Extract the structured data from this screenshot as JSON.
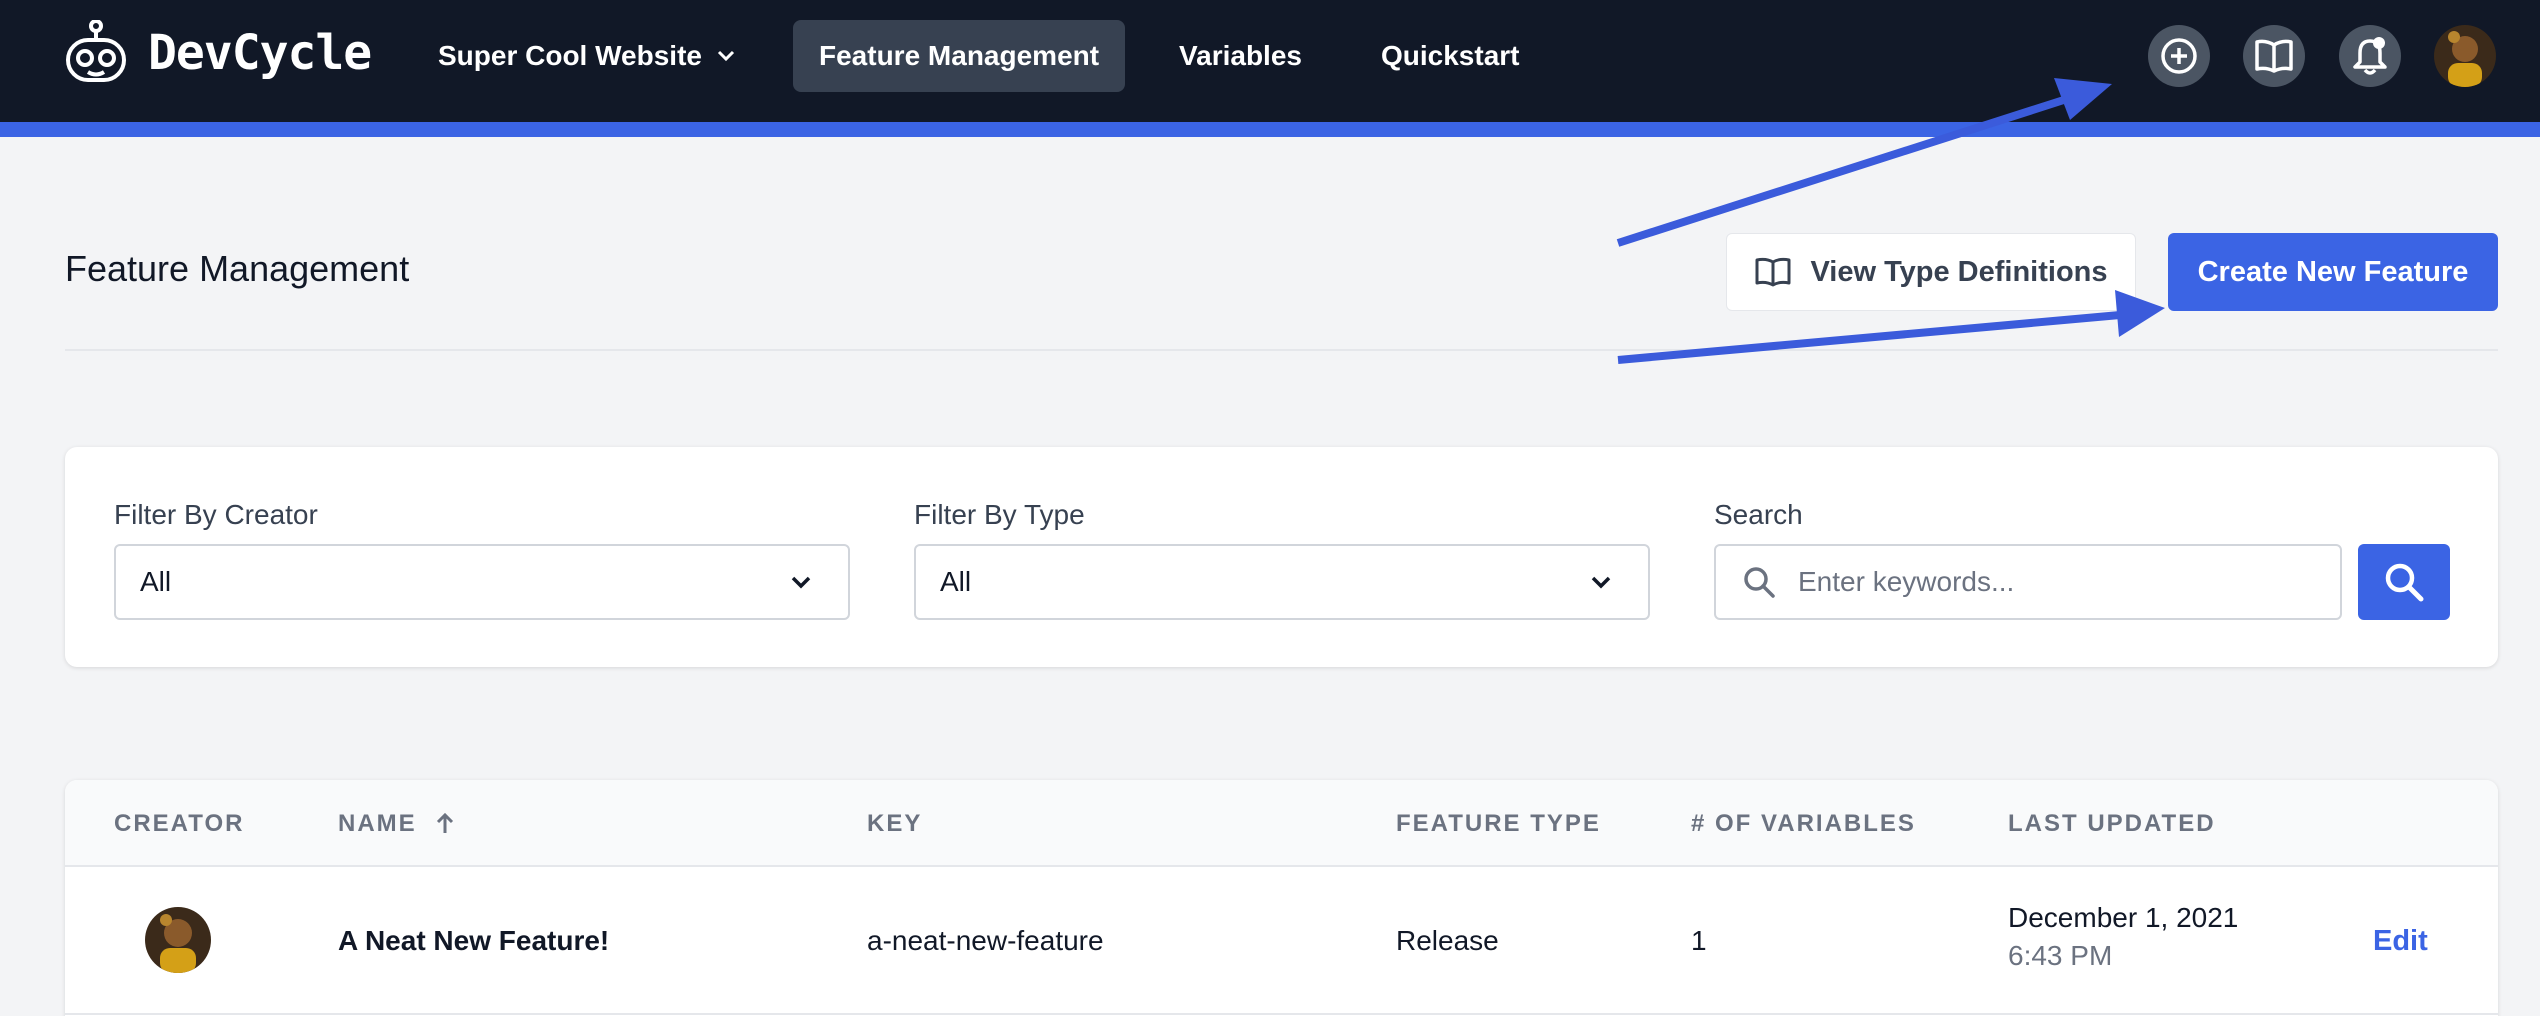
{
  "nav": {
    "brand": "DevCycle",
    "project_selector": "Super Cool Website",
    "links": [
      "Feature Management",
      "Variables",
      "Quickstart"
    ],
    "active_link": "Feature Management",
    "icons": [
      "plus-circle-icon",
      "book-open-icon",
      "bell-icon"
    ],
    "accent_color": "#3b64e4",
    "background_color": "#111827"
  },
  "header": {
    "title": "Feature Management",
    "view_type_definitions_label": "View Type Definitions",
    "create_new_feature_label": "Create New Feature"
  },
  "filters": {
    "creator": {
      "label": "Filter By Creator",
      "value": "All"
    },
    "type": {
      "label": "Filter By Type",
      "value": "All"
    },
    "search": {
      "label": "Search",
      "placeholder": "Enter keywords..."
    }
  },
  "table": {
    "columns": [
      "CREATOR",
      "NAME",
      "KEY",
      "FEATURE TYPE",
      "# OF VARIABLES",
      "LAST UPDATED"
    ],
    "sort_column": "NAME",
    "sort_direction": "ascending",
    "rows": [
      {
        "name": "A Neat New Feature!",
        "key": "a-neat-new-feature",
        "feature_type": "Release",
        "variables": "1",
        "last_updated_date": "December 1, 2021",
        "last_updated_time": "6:43 PM",
        "action": "Edit"
      }
    ]
  },
  "annotation_color": "#3b5bdb"
}
